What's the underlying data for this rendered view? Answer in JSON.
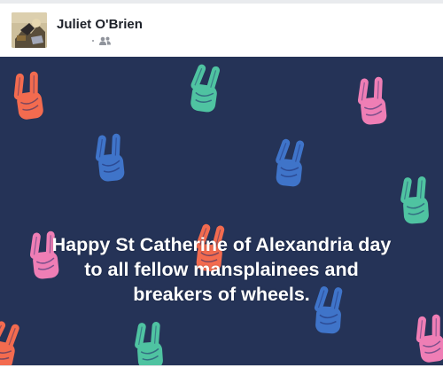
{
  "post": {
    "author_name": "Juliet O'Brien",
    "audience_icon": "friends-icon",
    "avatar_icon": "profile-photo"
  },
  "banner": {
    "lines": [
      "Happy St Catherine of Alexandria day",
      "to all fellow mansplainees and",
      "breakers of wheels."
    ],
    "background_color": "#253357",
    "pattern_icon": "peace-hand-icon",
    "hand_colors": [
      "#f36b4f",
      "#4fc3a1",
      "#ef7eb5",
      "#3f74c9"
    ]
  }
}
